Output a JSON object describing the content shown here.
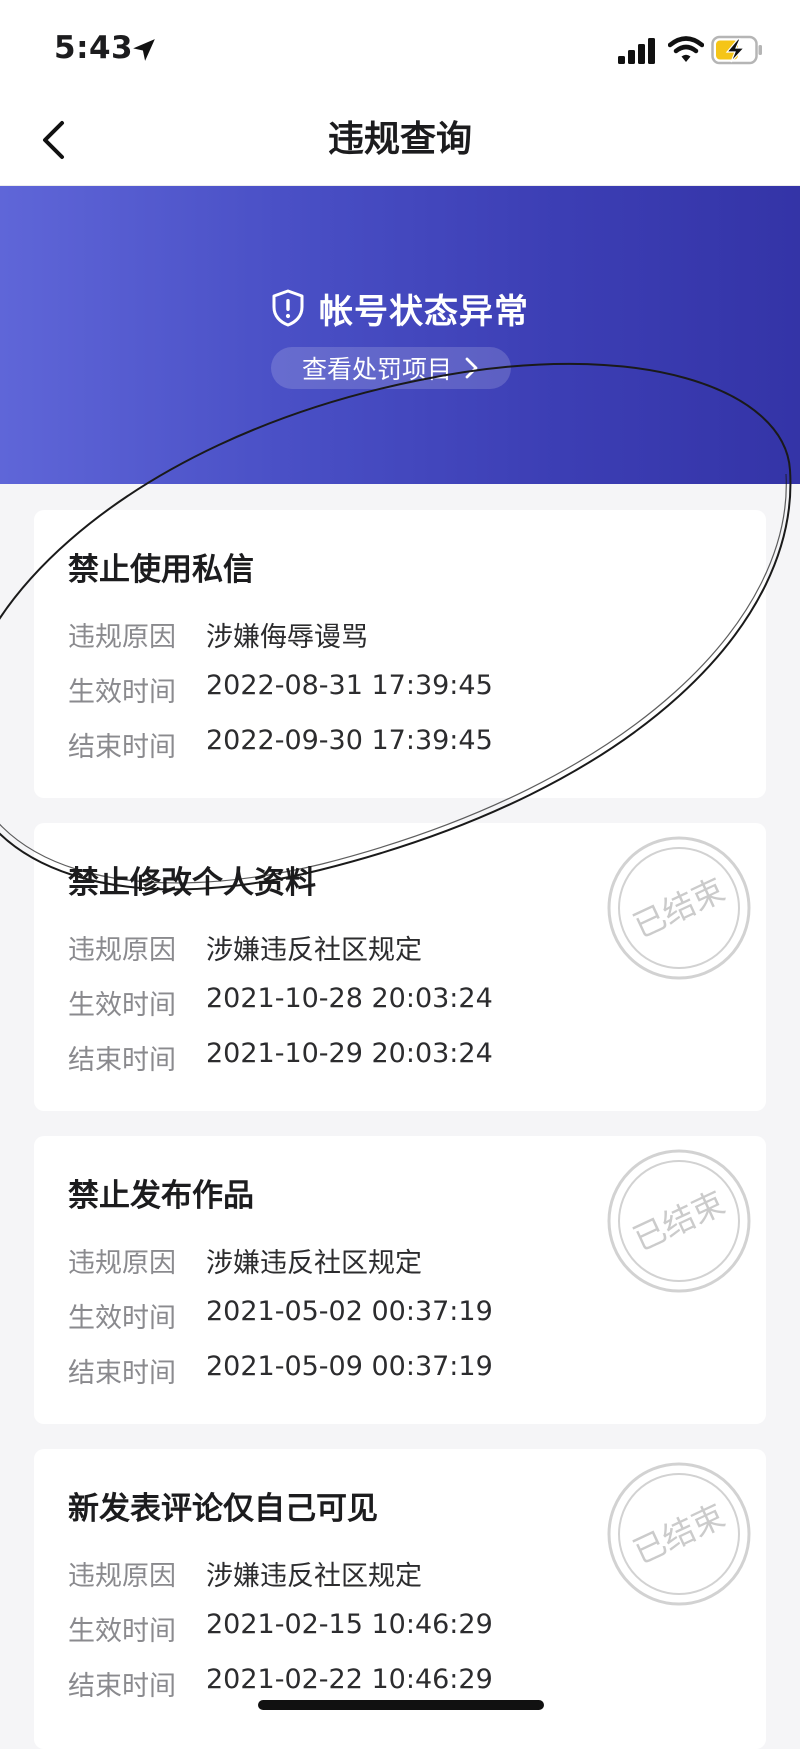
{
  "status_bar": {
    "time": "5:43"
  },
  "nav": {
    "title": "违规查询"
  },
  "banner": {
    "status_text": "帐号状态异常",
    "link_text": "查看处罚项目"
  },
  "labels": {
    "reason": "违规原因",
    "start": "生效时间",
    "end": "结束时间"
  },
  "stamp_text": "已结束",
  "violations": [
    {
      "title": "禁止使用私信",
      "reason": "涉嫌侮辱谩骂",
      "start": "2022-08-31 17:39:45",
      "end": "2022-09-30 17:39:45",
      "ended": false
    },
    {
      "title": "禁止修改个人资料",
      "reason": "涉嫌违反社区规定",
      "start": "2021-10-28 20:03:24",
      "end": "2021-10-29 20:03:24",
      "ended": true
    },
    {
      "title": "禁止发布作品",
      "reason": "涉嫌违反社区规定",
      "start": "2021-05-02 00:37:19",
      "end": "2021-05-09 00:37:19",
      "ended": true
    },
    {
      "title": "新发表评论仅自己可见",
      "reason": "涉嫌违反社区规定",
      "start": "2021-02-15 10:46:29",
      "end": "2021-02-22 10:46:29",
      "ended": true
    }
  ],
  "colors": {
    "banner_start": "#5f66d8",
    "banner_end": "#3434a7",
    "label_gray": "#8a8a8e",
    "battery_yellow": "#f5c518"
  }
}
